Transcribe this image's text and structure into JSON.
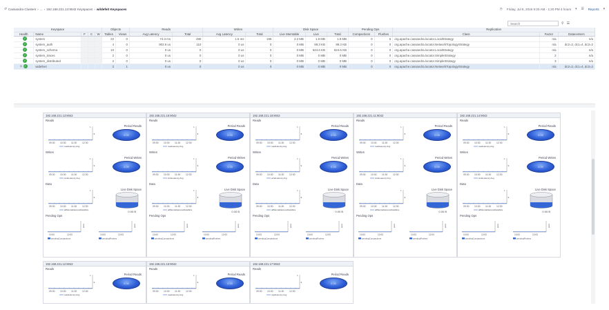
{
  "header": {
    "breadcrumb": [
      {
        "label": "Cassandra Clusters"
      },
      {
        "label": "..."
      },
      {
        "label": "192.168.221.13:9042 Keyspaces"
      },
      {
        "label": "wildefeit Keyspaces",
        "current": true
      }
    ],
    "datetime": "Friday, Jul 8, 2016 9:20 AM - 1:20 PM 4 hours",
    "reports_label": "Reports"
  },
  "search": {
    "placeholder": "Search"
  },
  "table": {
    "group_headers": {
      "keyspace": "Keyspace",
      "objects": "Objects",
      "reads": "Reads",
      "writes": "Writes",
      "disk_space": "Disk Space",
      "pending_ops": "Pending Ops",
      "replication": "Replication"
    },
    "columns": {
      "health": "Health",
      "name": "Name",
      "f": "F",
      "c": "C",
      "w": "W",
      "tables": "Tables",
      "views": "Views",
      "read_avg_latency": "Avg Latency",
      "read_total": "Total",
      "write_avg_latency": "Avg Latency",
      "write_total": "Total",
      "live_memtable": "Live Memtable",
      "live": "Live",
      "disk_total": "Total",
      "compactions": "Compactions",
      "flushes": "Flushes",
      "class": "Class",
      "factor": "Factor",
      "datacenters": "Datacenters"
    },
    "rows": [
      {
        "name": "system",
        "tables": "22",
        "views": "0",
        "read_lat": "74.3 ms",
        "read_total": "480",
        "write_lat": "1.5 ms",
        "write_total": "196",
        "memtable": "2.2 MB",
        "live": "1.9 MB",
        "total": "1.9 MB",
        "compactions": "0",
        "flushes": "6",
        "class": "org.apache.cassandra.locator.LocalStrategy",
        "factor": "n/a",
        "dcs": "n/a"
      },
      {
        "name": "system_auth",
        "tables": "4",
        "views": "0",
        "read_lat": "902.6 us",
        "read_total": "110",
        "write_lat": "0 us",
        "write_total": "0",
        "memtable": "0 MB",
        "live": "89.3 KB",
        "total": "89.3 KB",
        "compactions": "0",
        "flushes": "0",
        "class": "org.apache.cassandra.locator.NetworkTopologyStrategy",
        "factor": "n/a",
        "dcs": "dc2=2, dc1=4, dc3=2"
      },
      {
        "name": "system_schema",
        "tables": "10",
        "views": "0",
        "read_lat": "0 us",
        "read_total": "0",
        "write_lat": "0 us",
        "write_total": "0",
        "memtable": "0 MB",
        "live": "624.6 KB",
        "total": "624.6 KB",
        "compactions": "0",
        "flushes": "0",
        "class": "org.apache.cassandra.locator.LocalStrategy",
        "factor": "n/a",
        "dcs": "n/a"
      },
      {
        "name": "system_traces",
        "tables": "2",
        "views": "0",
        "read_lat": "0 us",
        "read_total": "0",
        "write_lat": "0 us",
        "write_total": "0",
        "memtable": "0 MB",
        "live": "0 MB",
        "total": "0 MB",
        "compactions": "0",
        "flushes": "0",
        "class": "org.apache.cassandra.locator.SimpleStrategy",
        "factor": "2",
        "dcs": "n/a"
      },
      {
        "name": "system_distributed",
        "tables": "2",
        "views": "0",
        "read_lat": "0 us",
        "read_total": "0",
        "write_lat": "0 us",
        "write_total": "0",
        "memtable": "0 MB",
        "live": "0 MB",
        "total": "0 MB",
        "compactions": "0",
        "flushes": "0",
        "class": "org.apache.cassandra.locator.SimpleStrategy",
        "factor": "3",
        "dcs": "n/a"
      },
      {
        "name": "widefeet",
        "tables": "2",
        "views": "1",
        "read_lat": "0 us",
        "read_total": "0",
        "write_lat": "0 us",
        "write_total": "0",
        "memtable": "0 MB",
        "live": "0 MB",
        "total": "0 MB",
        "compactions": "0",
        "flushes": "0",
        "class": "org.apache.cassandra.locator.NetworkTopologyStrategy",
        "factor": "n/a",
        "dcs": "dc2=2, dc1=4, dc3=2",
        "selected": true
      }
    ]
  },
  "panel_labels": {
    "reads": "Reads",
    "writes": "Writes",
    "data": "Data",
    "pending": "Pending Ops",
    "period_reads": "Period Reads",
    "period_writes": "Period Writes",
    "live_disk": "Live Disk Space",
    "oval_value": "0.00",
    "disk_value": "0.00 B",
    "read_legend": "readLatency.Avg",
    "write_legend": "writeLatency.Avg",
    "data_legend": "allMemtablesLiveDataSize",
    "compactions_legend": "pendingCompactions",
    "flushes_legend": "pendingFlushes",
    "axis_times": [
      "09:30",
      "10:30",
      "11:30",
      "12:30"
    ],
    "pend_times": [
      "10:00",
      "12:00"
    ],
    "y_unit": "s",
    "y_top": "1",
    "y_pend": "pend"
  },
  "panels": [
    {
      "title": "192.168.221.13:9042",
      "full": true
    },
    {
      "title": "192.168.221.16:9042",
      "full": true
    },
    {
      "title": "192.168.221.18:9042",
      "full": true
    },
    {
      "title": "192.168.221.11:9042",
      "full": true
    },
    {
      "title": "192.168.221.14:9042",
      "full": true
    },
    {
      "title": "192.168.221.12:9042",
      "full": false
    },
    {
      "title": "192.168.221.15:9042",
      "full": false
    },
    {
      "title": "192.168.221.17:9042",
      "full": false
    }
  ],
  "colors": {
    "accent": "#3466d6",
    "health_ok": "#3aa84a",
    "link": "#2a5c9a"
  }
}
